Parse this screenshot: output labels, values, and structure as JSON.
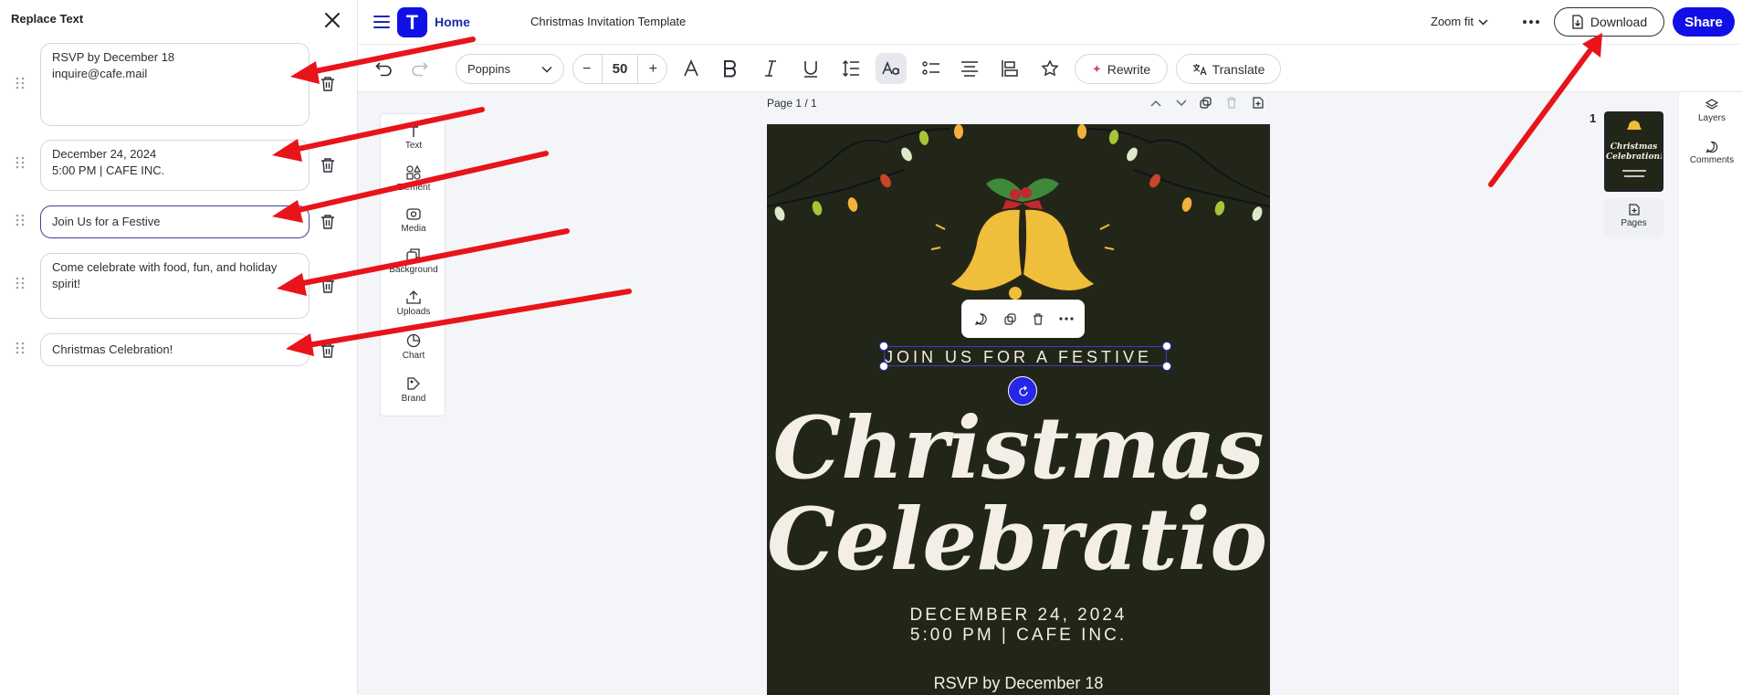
{
  "left_panel": {
    "title": "Replace Text",
    "fields": [
      {
        "value": "RSVP by December 18\ninquire@cafe.mail"
      },
      {
        "value": "December 24, 2024\n5:00 PM | CAFE INC."
      },
      {
        "value": "Join Us for a Festive"
      },
      {
        "value": "Come celebrate with food, fun, and holiday\nspirit!"
      },
      {
        "value": "Christmas Celebration!"
      }
    ]
  },
  "header": {
    "logo_letter": "T",
    "home_label": "Home",
    "doc_title": "Christmas Invitation Template",
    "zoom_label": "Zoom fit",
    "download_label": "Download",
    "share_label": "Share"
  },
  "toolbar": {
    "font_family": "Poppins",
    "font_size": "50",
    "rewrite_label": "Rewrite",
    "translate_label": "Translate"
  },
  "side_tools": [
    {
      "label": "Text",
      "icon": "text-icon"
    },
    {
      "label": "Element",
      "icon": "element-icon"
    },
    {
      "label": "Media",
      "icon": "media-icon"
    },
    {
      "label": "Background",
      "icon": "background-icon"
    },
    {
      "label": "Uploads",
      "icon": "upload-icon"
    },
    {
      "label": "Chart",
      "icon": "chart-icon"
    },
    {
      "label": "Brand",
      "icon": "brand-icon"
    }
  ],
  "page_bar": {
    "label": "Page 1 / 1"
  },
  "design": {
    "tagline": "JOIN US FOR A FESTIVE",
    "title_line1": "Christmas",
    "title_line2": "Celebration!",
    "date": "DECEMBER 24, 2024",
    "time_place": "5:00 PM | CAFE INC.",
    "rsvp": "RSVP by December 18",
    "thumb_title_line1": "Christmas",
    "thumb_title_line2": "Celebration!"
  },
  "pages_panel": {
    "page_number": "1",
    "pages_label": "Pages"
  },
  "right_rail": {
    "layers_label": "Layers",
    "comments_label": "Comments"
  },
  "colors": {
    "accent": "#1010e6",
    "page_bg": "#222618",
    "annotation_arrow": "#e8141a"
  }
}
